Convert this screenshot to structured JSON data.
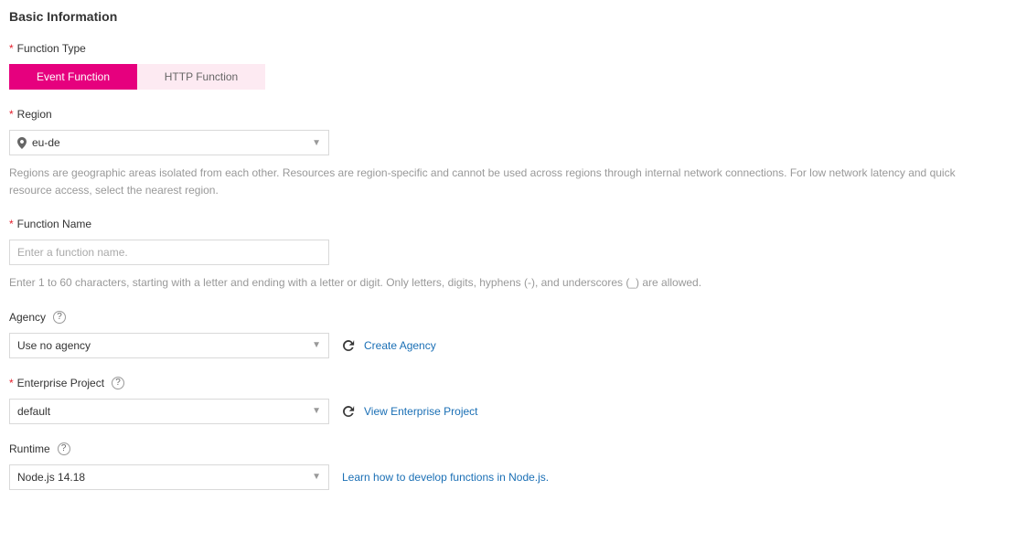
{
  "section_title": "Basic Information",
  "function_type": {
    "label": "Function Type",
    "event_tab": "Event Function",
    "http_tab": "HTTP Function"
  },
  "region": {
    "label": "Region",
    "value": "eu-de",
    "helper": "Regions are geographic areas isolated from each other. Resources are region-specific and cannot be used across regions through internal network connections. For low network latency and quick resource access, select the nearest region."
  },
  "function_name": {
    "label": "Function Name",
    "placeholder": "Enter a function name.",
    "value": "",
    "helper": "Enter 1 to 60 characters, starting with a letter and ending with a letter or digit. Only letters, digits, hyphens (-), and underscores (_) are allowed."
  },
  "agency": {
    "label": "Agency",
    "value": "Use no agency",
    "create_link": "Create Agency"
  },
  "enterprise_project": {
    "label": "Enterprise Project",
    "value": "default",
    "view_link": "View Enterprise Project"
  },
  "runtime": {
    "label": "Runtime",
    "value": "Node.js 14.18",
    "learn_link": "Learn how to develop functions in Node.js."
  }
}
